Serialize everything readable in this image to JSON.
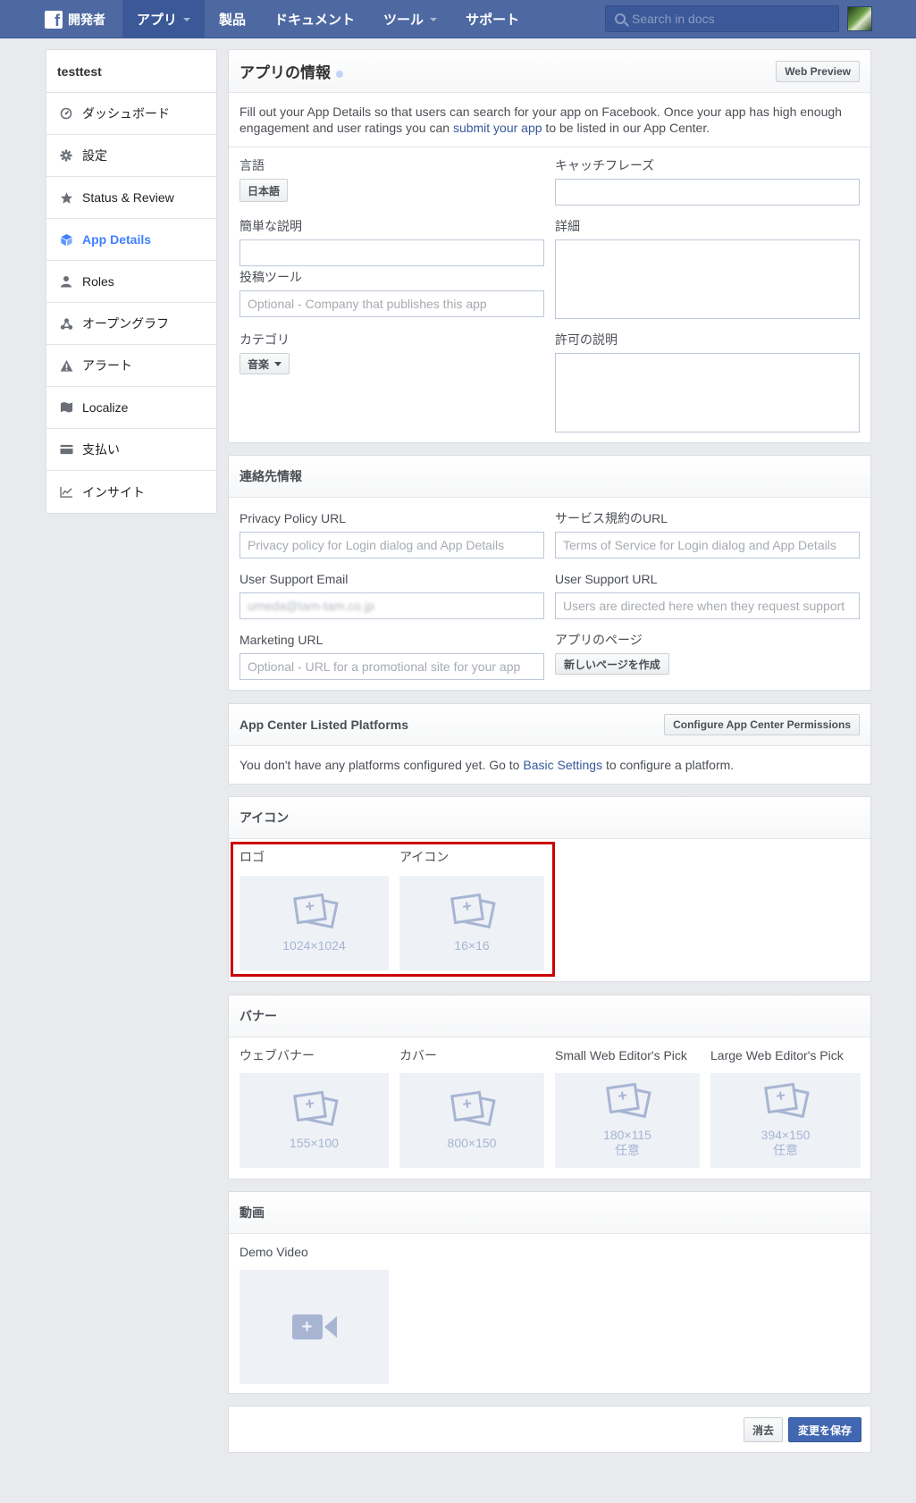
{
  "topbar": {
    "logo_glyph": "f",
    "brand": "開発者",
    "nav": [
      {
        "label": "アプリ",
        "dropdown": true,
        "active": true
      },
      {
        "label": "製品",
        "dropdown": false
      },
      {
        "label": "ドキュメント",
        "dropdown": false
      },
      {
        "label": "ツール",
        "dropdown": true
      },
      {
        "label": "サポート",
        "dropdown": false
      }
    ],
    "search_placeholder": "Search in docs"
  },
  "sidebar": {
    "app_name": "testtest",
    "items": [
      {
        "label": "ダッシュボード",
        "icon": "dashboard-icon"
      },
      {
        "label": "設定",
        "icon": "gear-icon"
      },
      {
        "label": "Status & Review",
        "icon": "star-icon"
      },
      {
        "label": "App Details",
        "icon": "cube-icon",
        "active": true
      },
      {
        "label": "Roles",
        "icon": "person-icon"
      },
      {
        "label": "オープングラフ",
        "icon": "graph-icon"
      },
      {
        "label": "アラート",
        "icon": "warning-icon"
      },
      {
        "label": "Localize",
        "icon": "flag-icon"
      },
      {
        "label": "支払い",
        "icon": "card-icon"
      },
      {
        "label": "インサイト",
        "icon": "chart-icon"
      }
    ]
  },
  "app_info": {
    "title": "アプリの情報",
    "web_preview": "Web Preview",
    "intro_1": "Fill out your App Details so that users can search for your app on Facebook. Once your app has high enough engagement and user ratings you can ",
    "intro_link": "submit your app",
    "intro_2": " to be listed in our App Center.",
    "language_label": "言語",
    "language_value": "日本語",
    "tagline_label": "キャッチフレーズ",
    "short_desc_label": "簡単な説明",
    "long_desc_label": "詳細",
    "publisher_label": "投稿ツール",
    "publisher_placeholder": "Optional - Company that publishes this app",
    "category_label": "カテゴリ",
    "category_value": "音楽",
    "permission_label": "許可の説明"
  },
  "contact": {
    "title": "連絡先情報",
    "privacy_label": "Privacy Policy URL",
    "privacy_placeholder": "Privacy policy for Login dialog and App Details",
    "tos_label": "サービス規約のURL",
    "tos_placeholder": "Terms of Service for Login dialog and App Details",
    "email_label": "User Support Email",
    "email_value": "umeda@tam-tam.co.jp",
    "support_url_label": "User Support URL",
    "support_url_placeholder": "Users are directed here when they request support",
    "marketing_label": "Marketing URL",
    "marketing_placeholder": "Optional - URL for a promotional site for your app",
    "app_page_label": "アプリのページ",
    "app_page_button": "新しいページを作成"
  },
  "platforms": {
    "title": "App Center Listed Platforms",
    "configure_button": "Configure App Center Permissions",
    "text_1": "You don't have any platforms configured yet. Go to ",
    "link": "Basic Settings",
    "text_2": " to configure a platform."
  },
  "icons": {
    "title": "アイコン",
    "logo_label": "ロゴ",
    "logo_dim": "1024×1024",
    "icon_label": "アイコン",
    "icon_dim": "16×16"
  },
  "banners": {
    "title": "バナー",
    "items": [
      {
        "label": "ウェブバナー",
        "dim": "155×100",
        "note": ""
      },
      {
        "label": "カバー",
        "dim": "800×150",
        "note": ""
      },
      {
        "label": "Small Web Editor's Pick",
        "dim": "180×115",
        "note": "任意"
      },
      {
        "label": "Large Web Editor's Pick",
        "dim": "394×150",
        "note": "任意"
      }
    ]
  },
  "video": {
    "title": "動画",
    "demo_label": "Demo Video",
    "plus": "+"
  },
  "footer": {
    "discard": "消去",
    "save": "変更を保存"
  },
  "colors": {
    "topbar": "#4e69a2",
    "accent": "#4080ff",
    "highlight": "#cc0000",
    "primary_button": "#4267b2"
  }
}
